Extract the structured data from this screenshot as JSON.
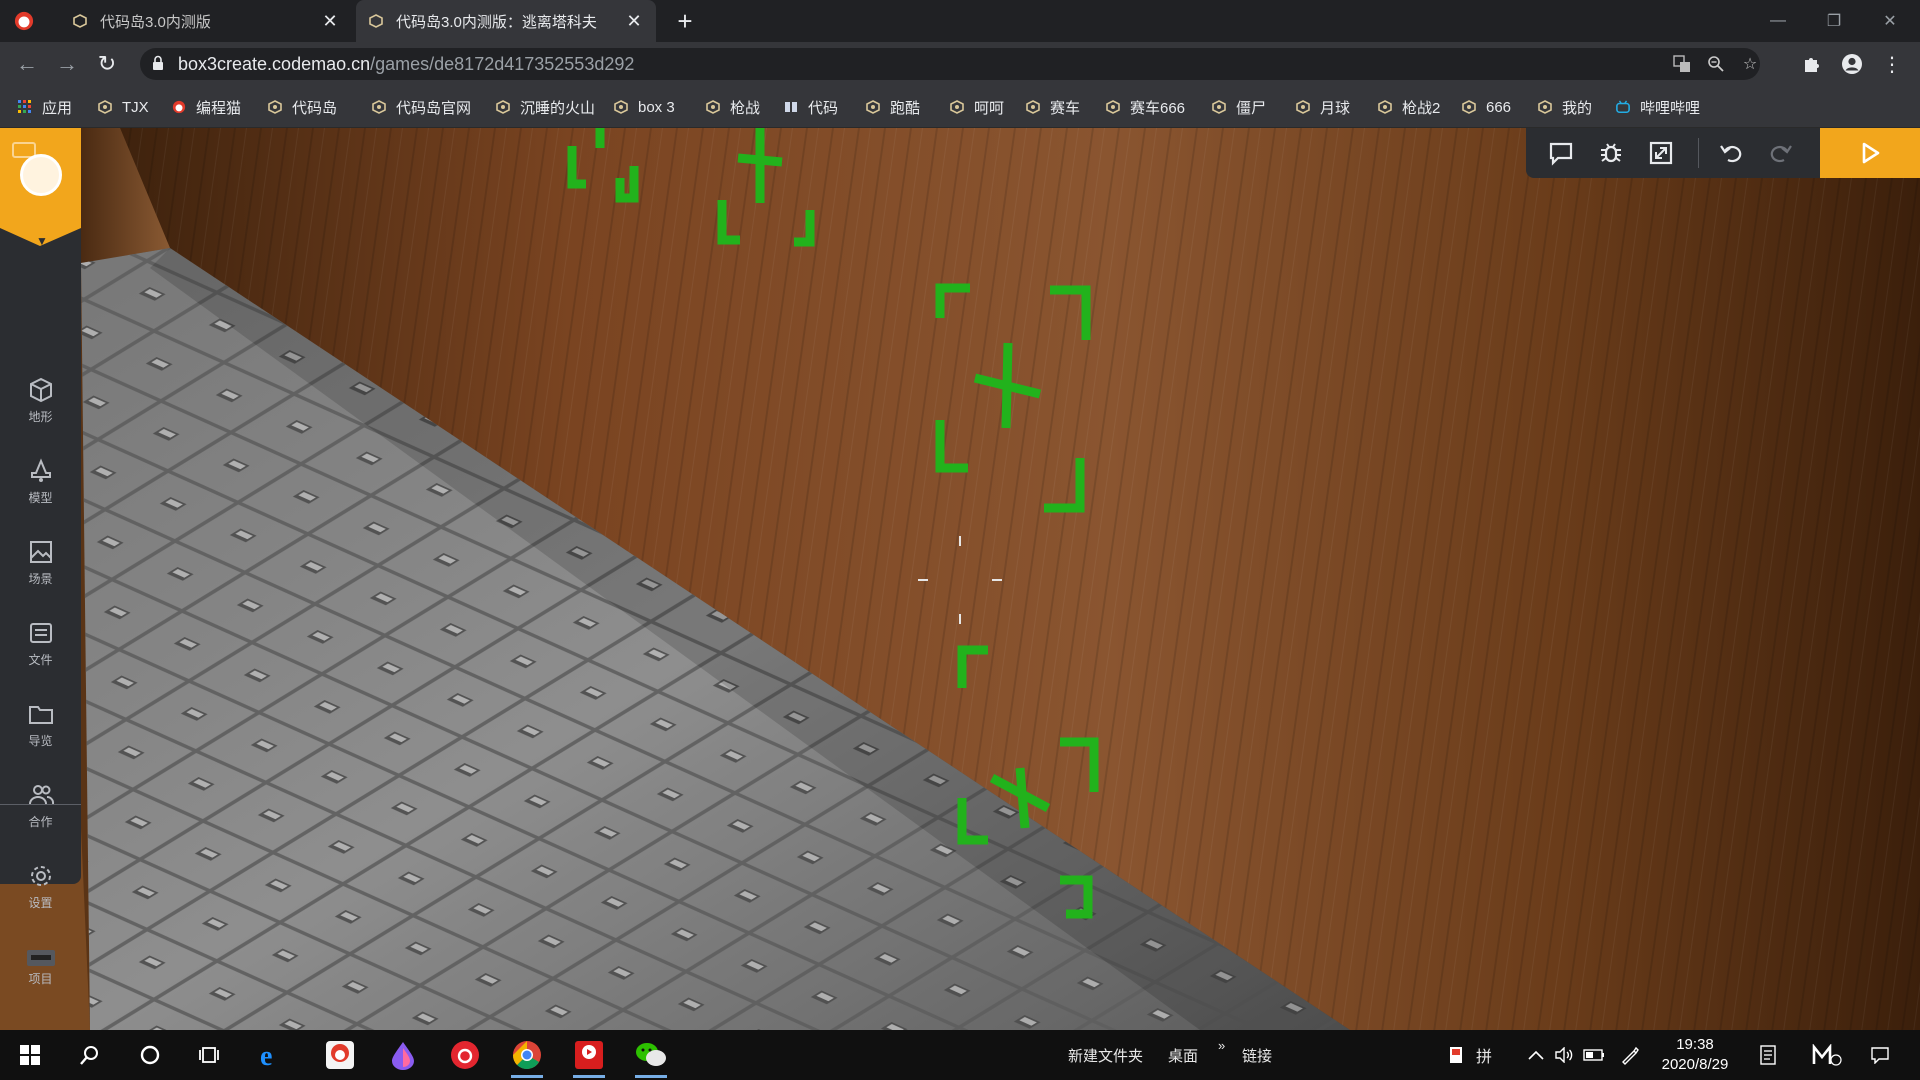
{
  "browser": {
    "tabs": [
      {
        "title": "代码岛3.0内测版",
        "active": false
      },
      {
        "title": "代码岛3.0内测版：逃离塔科夫",
        "active": true
      }
    ],
    "url_domain": "box3create.codemao.cn",
    "url_path": "/games/de8172d417352553d292",
    "bookmarks": [
      {
        "label": "应用",
        "icon": "apps-grid-icon"
      },
      {
        "label": "TJX",
        "icon": "box3-icon"
      },
      {
        "label": "编程猫",
        "icon": "codemao-cat-icon"
      },
      {
        "label": "代码岛",
        "icon": "box3-icon"
      },
      {
        "label": "代码岛官网",
        "icon": "box3-icon"
      },
      {
        "label": "沉睡的火山",
        "icon": "box3-icon"
      },
      {
        "label": "box 3",
        "icon": "box3-icon"
      },
      {
        "label": "枪战",
        "icon": "box3-icon"
      },
      {
        "label": "代码",
        "icon": "book-icon"
      },
      {
        "label": "跑酷",
        "icon": "box3-icon"
      },
      {
        "label": "呵呵",
        "icon": "box3-icon"
      },
      {
        "label": "赛车",
        "icon": "box3-icon"
      },
      {
        "label": "赛车666",
        "icon": "box3-icon"
      },
      {
        "label": "僵尸",
        "icon": "box3-icon"
      },
      {
        "label": "月球",
        "icon": "box3-icon"
      },
      {
        "label": "枪战2",
        "icon": "box3-icon"
      },
      {
        "label": "666",
        "icon": "box3-icon"
      },
      {
        "label": "我的",
        "icon": "box3-icon"
      },
      {
        "label": "哔哩哔哩",
        "icon": "bilibili-icon"
      }
    ]
  },
  "sidebar": {
    "items": [
      {
        "label": "地形",
        "icon": "cube-icon"
      },
      {
        "label": "模型",
        "icon": "bell-icon"
      },
      {
        "label": "场景",
        "icon": "image-icon"
      },
      {
        "label": "文件",
        "icon": "file-list-icon"
      },
      {
        "label": "导览",
        "icon": "folder-icon"
      },
      {
        "label": "合作",
        "icon": "users-icon"
      },
      {
        "label": "设置",
        "icon": "gear-icon"
      }
    ],
    "project_label": "项目"
  },
  "game_toolbar": [
    "chat-icon",
    "bug-icon",
    "fullscreen-icon",
    "undo-icon",
    "redo-icon",
    "play-icon"
  ],
  "colors": {
    "accent": "#f2a61c",
    "crosshair": "#22b21c",
    "wall": "#7a4a22",
    "floor": "#8c8c8c"
  },
  "taskbar": {
    "apps": [
      "start-icon",
      "search-icon",
      "cortana-icon",
      "task-view-icon",
      "ie-icon",
      "codemao-icon",
      "drop-icon",
      "netease-music-icon",
      "chrome-icon",
      "video-app-icon",
      "wechat-icon"
    ],
    "toolbar_labels": [
      "新建文件夹",
      "桌面",
      "链接"
    ],
    "ime": "拼",
    "time": "19:38",
    "date": "2020/8/29"
  }
}
